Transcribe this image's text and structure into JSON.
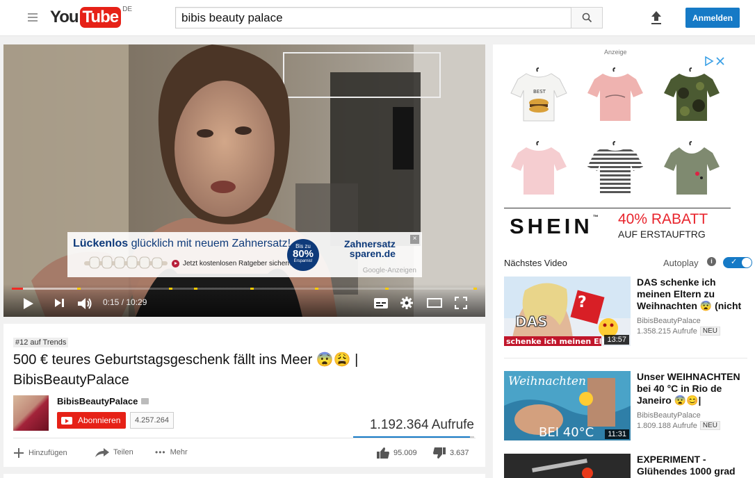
{
  "masthead": {
    "logo_you": "You",
    "logo_tube": "Tube",
    "country": "DE",
    "search_value": "bibis beauty palace",
    "signin_label": "Anmelden"
  },
  "player": {
    "time_current": "0:15",
    "time_total": "10:29",
    "time_display": "0:15 / 10:29",
    "progress_played_fraction": 0.024,
    "progress_loaded_fraction": 0.14,
    "overlay_ad": {
      "headline_bold": "Lückenlos",
      "headline_rest": " glücklich mit neuem Zahnersatz!",
      "cta": "Jetzt kostenlosen Ratgeber sichern!",
      "badge_top": "Bis zu",
      "badge_value": "80%",
      "badge_bottom": "Ersparnis!",
      "brand_line1": "Zahnersatz",
      "brand_line2": "sparen.de",
      "google_label": "Google-Anzeigen",
      "close_label": "×"
    }
  },
  "video": {
    "trend_badge": "#12 auf Trends",
    "title": "500 € teures Geburtstagsgeschenk fällt ins Meer 😨😩 | BibisBeautyPalace",
    "channel": "BibisBeautyPalace",
    "subscribe_label": "Abonnieren",
    "subscriber_count": "4.257.264",
    "views": "1.192.364 Aufrufe",
    "like_ratio": 0.963,
    "actions": {
      "add_label": "Hinzufügen",
      "share_label": "Teilen",
      "more_label": "Mehr"
    },
    "likes": "95.009",
    "dislikes": "3.637"
  },
  "sidebar": {
    "ad_label": "Anzeige",
    "ad": {
      "brand": "SHEIN",
      "tm": "™",
      "discount": "40% RABATT",
      "discount_sub": "AUF ERSTAUFTRG",
      "shirt1_print": "BEST"
    },
    "up_next_label": "Nächstes Video",
    "autoplay_label": "Autoplay",
    "autoplay_on": true,
    "recommendations": [
      {
        "title": "DAS schenke ich meinen Eltern zu Weihnachten 😨 (nicht",
        "channel": "BibisBeautyPalace",
        "views": "1.358.215 Aufrufe",
        "badge": "NEU",
        "duration": "13:57",
        "thumb_text": "schenke ich meinen Eltern",
        "thumb_top": "DAS"
      },
      {
        "title": "Unser WEIHNACHTEN bei 40 °C in Rio de Janeiro 😨😊|",
        "channel": "BibisBeautyPalace",
        "views": "1.809.188 Aufrufe",
        "badge": "NEU",
        "duration": "11:31",
        "thumb_text": "Weihnachten",
        "thumb_bottom": "BEI 40°C"
      },
      {
        "title": "EXPERIMENT - Glühendes 1000 grad"
      }
    ]
  }
}
